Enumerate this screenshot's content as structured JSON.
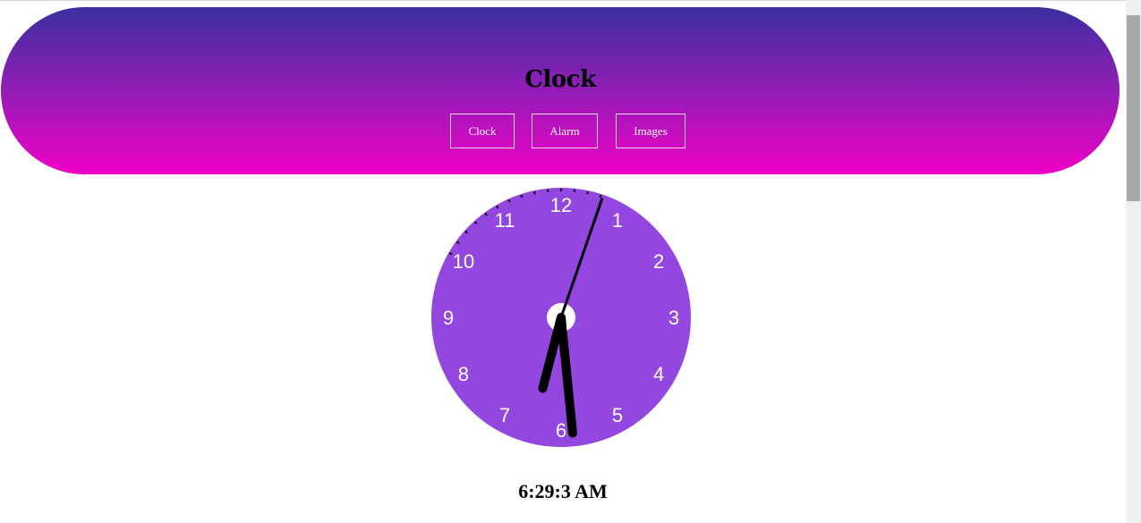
{
  "header": {
    "title": "Clock",
    "nav": [
      {
        "label": "Clock"
      },
      {
        "label": "Alarm"
      },
      {
        "label": "Images"
      }
    ]
  },
  "clock": {
    "face_color": "#9347e0",
    "hand_color": "#000000",
    "center_color": "#ffffff",
    "numbers": [
      "12",
      "1",
      "2",
      "3",
      "4",
      "5",
      "6",
      "7",
      "8",
      "9",
      "10",
      "11"
    ],
    "time": {
      "hours": 6,
      "minutes": 29,
      "seconds": 3
    }
  },
  "digital_time": "6:29:3 AM",
  "colors": {
    "header_top": "#3b2ea0",
    "header_bottom": "#f000c8"
  }
}
